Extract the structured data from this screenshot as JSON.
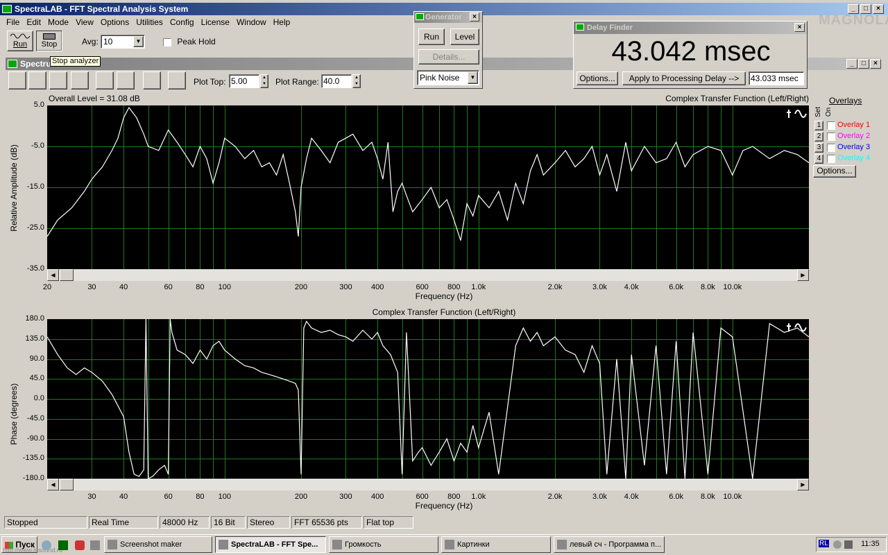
{
  "app": {
    "title": "SpectraLAB - FFT Spectral Analysis System"
  },
  "menu": [
    "File",
    "Edit",
    "Mode",
    "View",
    "Options",
    "Utilities",
    "Config",
    "License",
    "Window",
    "Help"
  ],
  "toolbar": {
    "run_label": "Run",
    "stop_label": "Stop",
    "avg_label": "Avg:",
    "avg_value": "10",
    "peak_hold_label": "Peak Hold",
    "tooltip": "Stop analyzer"
  },
  "generator": {
    "title": "Generator",
    "run_label": "Run",
    "level_label": "Level",
    "details_label": "Details...",
    "signal": "Pink Noise"
  },
  "delay_finder": {
    "title": "Delay Finder",
    "value": "43.042 msec",
    "options_label": "Options...",
    "apply_label": "Apply to Processing Delay -->",
    "result": "43.033 msec"
  },
  "watermark": {
    "text": "MAGNOLA"
  },
  "spectrum_window": {
    "title": "Spectrum",
    "plot_top_label": "Plot Top:",
    "plot_top_value": "5.00",
    "plot_range_label": "Plot Range:",
    "plot_range_value": "40.0"
  },
  "overlays": {
    "header": "Overlays",
    "set_label": "Set",
    "on_label": "On",
    "items": [
      {
        "num": "1",
        "label": "Overlay 1",
        "color": "#ff0000"
      },
      {
        "num": "2",
        "label": "Overlay 2",
        "color": "#ff00ff"
      },
      {
        "num": "3",
        "label": "Overlay 3",
        "color": "#0000ff"
      },
      {
        "num": "4",
        "label": "Overlay 4",
        "color": "#00ffff"
      }
    ],
    "options_label": "Options..."
  },
  "chart_data": [
    {
      "type": "line",
      "title": "Complex Transfer Function (Left/Right)",
      "subtitle": "Overall Level = 31.08 dB",
      "xlabel": "Frequency (Hz)",
      "ylabel": "Relative Amplitude (dB)",
      "xscale": "log",
      "xlim": [
        20,
        20000
      ],
      "ylim": [
        -35,
        5
      ],
      "yticks": [
        "5.0",
        "-5.0",
        "-15.0",
        "-25.0",
        "-35.0"
      ],
      "xticks": [
        {
          "v": 20,
          "t": "20"
        },
        {
          "v": 30,
          "t": "30"
        },
        {
          "v": 40,
          "t": "40"
        },
        {
          "v": 60,
          "t": "60"
        },
        {
          "v": 80,
          "t": "80"
        },
        {
          "v": 100,
          "t": "100"
        },
        {
          "v": 200,
          "t": "200"
        },
        {
          "v": 300,
          "t": "300"
        },
        {
          "v": 400,
          "t": "400"
        },
        {
          "v": 600,
          "t": "600"
        },
        {
          "v": 800,
          "t": "800"
        },
        {
          "v": 1000,
          "t": "1.0k"
        },
        {
          "v": 2000,
          "t": "2.0k"
        },
        {
          "v": 3000,
          "t": "3.0k"
        },
        {
          "v": 4000,
          "t": "4.0k"
        },
        {
          "v": 6000,
          "t": "6.0k"
        },
        {
          "v": 8000,
          "t": "8.0k"
        },
        {
          "v": 10000,
          "t": "10.0k"
        }
      ],
      "series": [
        {
          "color": "#ffffff",
          "x": [
            20,
            22,
            25,
            28,
            30,
            33,
            36,
            38,
            40,
            42,
            45,
            48,
            50,
            55,
            60,
            65,
            70,
            75,
            80,
            85,
            90,
            95,
            100,
            110,
            120,
            130,
            140,
            150,
            160,
            170,
            180,
            190,
            195,
            200,
            210,
            220,
            240,
            260,
            280,
            300,
            320,
            350,
            380,
            400,
            420,
            440,
            460,
            480,
            500,
            520,
            550,
            600,
            650,
            700,
            750,
            800,
            850,
            900,
            950,
            1000,
            1100,
            1200,
            1300,
            1400,
            1500,
            1600,
            1700,
            1800,
            2000,
            2200,
            2400,
            2600,
            2800,
            3000,
            3200,
            3500,
            3800,
            4000,
            4500,
            5000,
            5500,
            6000,
            6500,
            7000,
            8000,
            9000,
            10000,
            11000,
            12000,
            14000,
            16000,
            18000,
            20000
          ],
          "y": [
            -27,
            -23,
            -20,
            -16,
            -13,
            -10,
            -6,
            -3,
            2,
            4.5,
            2,
            -2,
            -5,
            -6,
            -1,
            -4,
            -7,
            -10,
            -5,
            -8,
            -14,
            -9,
            -3,
            -5,
            -8,
            -6,
            -10,
            -9,
            -12,
            -7,
            -14,
            -21,
            -27,
            -15,
            -8,
            -3,
            -6,
            -9,
            -4,
            -3,
            -2,
            -6,
            -4,
            -8,
            -13,
            -4,
            -21,
            -16,
            -14,
            -17,
            -21,
            -18,
            -15,
            -20,
            -18,
            -23,
            -28,
            -19,
            -22,
            -17,
            -20,
            -16,
            -23,
            -14,
            -19,
            -11,
            -7,
            -12,
            -9,
            -6,
            -10,
            -8,
            -5,
            -12,
            -7,
            -16,
            -4,
            -11,
            -5,
            -9,
            -8,
            -4,
            -10,
            -7,
            -5,
            -6,
            -12,
            -6,
            -5,
            -8,
            -6,
            -7,
            -9
          ]
        }
      ]
    },
    {
      "type": "line",
      "title": "Complex Transfer Function (Left/Right)",
      "xlabel": "Frequency (Hz)",
      "ylabel": "Phase (degrees)",
      "xscale": "log",
      "xlim": [
        20,
        20000
      ],
      "ylim": [
        -180,
        180
      ],
      "yticks": [
        "180.0",
        "135.0",
        "90.0",
        "45.0",
        "0.0",
        "-45.0",
        "-90.0",
        "-135.0",
        "-180.0"
      ],
      "xticks": [
        {
          "v": 30,
          "t": "30"
        },
        {
          "v": 40,
          "t": "40"
        },
        {
          "v": 60,
          "t": "60"
        },
        {
          "v": 80,
          "t": "80"
        },
        {
          "v": 100,
          "t": "100"
        },
        {
          "v": 200,
          "t": "200"
        },
        {
          "v": 300,
          "t": "300"
        },
        {
          "v": 400,
          "t": "400"
        },
        {
          "v": 600,
          "t": "600"
        },
        {
          "v": 800,
          "t": "800"
        },
        {
          "v": 1000,
          "t": "1.0k"
        },
        {
          "v": 2000,
          "t": "2.0k"
        },
        {
          "v": 3000,
          "t": "3.0k"
        },
        {
          "v": 4000,
          "t": "4.0k"
        },
        {
          "v": 6000,
          "t": "6.0k"
        },
        {
          "v": 8000,
          "t": "8.0k"
        },
        {
          "v": 10000,
          "t": "10.0k"
        }
      ],
      "series": [
        {
          "color": "#ffffff",
          "x": [
            20,
            22,
            24,
            26,
            28,
            30,
            33,
            36,
            40,
            42,
            44,
            46,
            48,
            49,
            50,
            52,
            55,
            58,
            60,
            61,
            62,
            65,
            70,
            75,
            80,
            85,
            90,
            95,
            100,
            110,
            120,
            130,
            140,
            150,
            160,
            170,
            180,
            190,
            195,
            200,
            205,
            210,
            220,
            240,
            260,
            280,
            300,
            320,
            350,
            380,
            400,
            420,
            450,
            480,
            500,
            520,
            550,
            580,
            600,
            650,
            700,
            750,
            800,
            850,
            900,
            950,
            1000,
            1100,
            1200,
            1300,
            1400,
            1500,
            1600,
            1700,
            1800,
            2000,
            2200,
            2400,
            2600,
            2800,
            3000,
            3200,
            3500,
            3800,
            4000,
            4500,
            5000,
            5500,
            6000,
            6500,
            7000,
            8000,
            9000,
            10000,
            12000,
            14000,
            16000,
            18000,
            20000
          ],
          "y": [
            140,
            100,
            70,
            55,
            70,
            60,
            40,
            10,
            -40,
            -120,
            -170,
            -175,
            -160,
            180,
            -180,
            -175,
            -160,
            -150,
            -170,
            180,
            150,
            110,
            100,
            80,
            110,
            90,
            120,
            130,
            110,
            90,
            75,
            70,
            60,
            55,
            50,
            45,
            40,
            35,
            20,
            -170,
            160,
            175,
            160,
            150,
            155,
            145,
            140,
            130,
            155,
            135,
            150,
            120,
            100,
            60,
            -170,
            150,
            -140,
            -120,
            -110,
            -150,
            -120,
            -90,
            -140,
            -100,
            -120,
            -60,
            -110,
            -30,
            -170,
            -20,
            120,
            160,
            130,
            150,
            120,
            140,
            110,
            100,
            60,
            120,
            80,
            -170,
            90,
            -180,
            100,
            -150,
            120,
            -170,
            130,
            -180,
            150,
            -170,
            160,
            140,
            -180,
            170,
            150,
            160,
            140
          ]
        }
      ]
    }
  ],
  "status": [
    "Stopped",
    "Real Time",
    "48000 Hz",
    "16 Bit",
    "Stereo",
    "FFT 65536 pts",
    "Flat top"
  ],
  "taskbar": {
    "start": "Пуск",
    "url": "http://www.lnsound.ru",
    "items": [
      "Screenshot maker",
      "SpectraLAB - FFT Spe...",
      "Громкость",
      "Картинки",
      "левый сч - Программа п..."
    ],
    "lang": "RL",
    "clock": "11:35"
  }
}
